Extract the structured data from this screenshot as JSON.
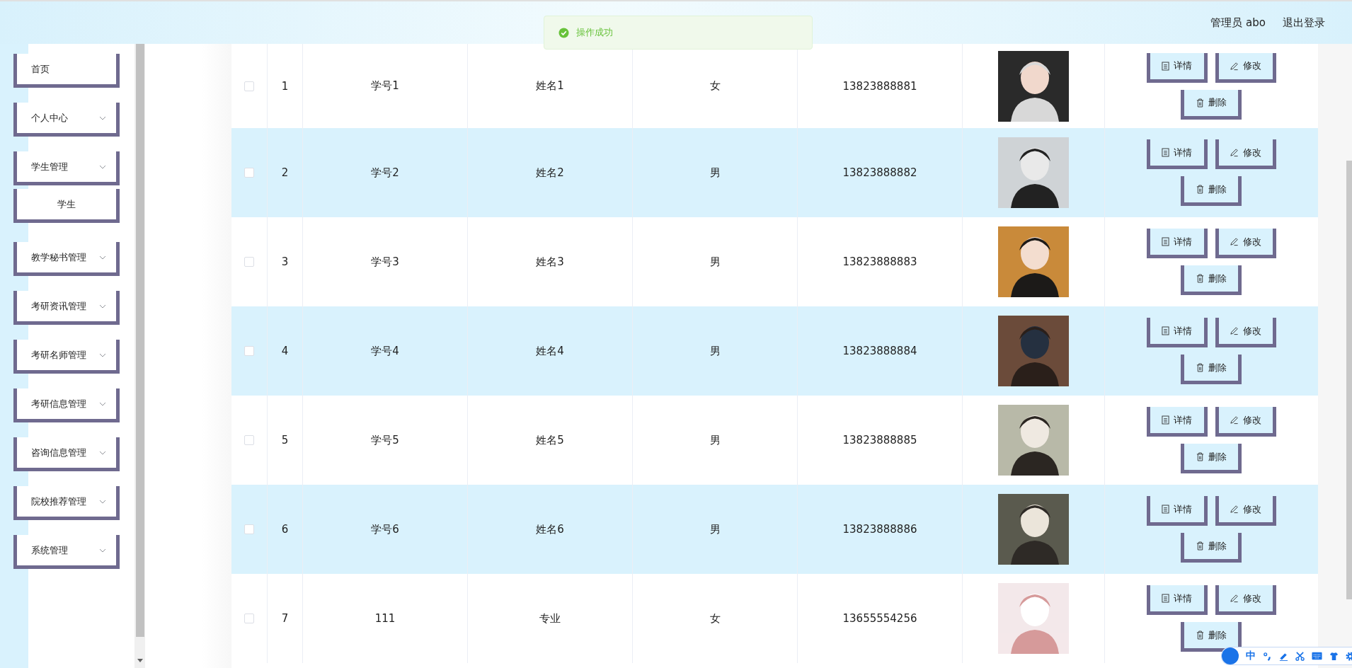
{
  "header": {
    "user": "管理员 abo",
    "logout": "退出登录"
  },
  "toast": {
    "message": "操作成功"
  },
  "sidebar": {
    "items": [
      {
        "label": "首页",
        "kind": "link"
      },
      {
        "label": "个人中心",
        "kind": "submenu"
      },
      {
        "label": "学生管理",
        "kind": "submenu",
        "children": [
          {
            "label": "学生"
          }
        ]
      },
      {
        "label": "教学秘书管理",
        "kind": "submenu"
      },
      {
        "label": "考研资讯管理",
        "kind": "submenu"
      },
      {
        "label": "考研名师管理",
        "kind": "submenu"
      },
      {
        "label": "考研信息管理",
        "kind": "submenu"
      },
      {
        "label": "咨询信息管理",
        "kind": "submenu"
      },
      {
        "label": "院校推荐管理",
        "kind": "submenu"
      },
      {
        "label": "系统管理",
        "kind": "submenu"
      }
    ]
  },
  "table": {
    "rows": [
      {
        "checked": false,
        "index": "1",
        "student_no": "学号1",
        "name": "姓名1",
        "gender": "女",
        "phone": "13823888881",
        "actions": [
          {
            "kind": "detail",
            "label": "详情"
          },
          {
            "kind": "edit",
            "label": "修改"
          },
          {
            "kind": "delete",
            "label": "删除"
          }
        ]
      },
      {
        "checked": false,
        "index": "2",
        "student_no": "学号2",
        "name": "姓名2",
        "gender": "男",
        "phone": "13823888882",
        "actions": [
          {
            "kind": "detail",
            "label": "详情"
          },
          {
            "kind": "edit",
            "label": "修改"
          },
          {
            "kind": "delete",
            "label": "删除"
          }
        ]
      },
      {
        "checked": false,
        "index": "3",
        "student_no": "学号3",
        "name": "姓名3",
        "gender": "男",
        "phone": "13823888883",
        "actions": [
          {
            "kind": "detail",
            "label": "详情"
          },
          {
            "kind": "edit",
            "label": "修改"
          },
          {
            "kind": "delete",
            "label": "删除"
          }
        ]
      },
      {
        "checked": false,
        "index": "4",
        "student_no": "学号4",
        "name": "姓名4",
        "gender": "男",
        "phone": "13823888884",
        "actions": [
          {
            "kind": "detail",
            "label": "详情"
          },
          {
            "kind": "edit",
            "label": "修改"
          },
          {
            "kind": "delete",
            "label": "删除"
          }
        ]
      },
      {
        "checked": false,
        "index": "5",
        "student_no": "学号5",
        "name": "姓名5",
        "gender": "男",
        "phone": "13823888885",
        "actions": [
          {
            "kind": "detail",
            "label": "详情"
          },
          {
            "kind": "edit",
            "label": "修改"
          },
          {
            "kind": "delete",
            "label": "删除"
          }
        ]
      },
      {
        "checked": false,
        "index": "6",
        "student_no": "学号6",
        "name": "姓名6",
        "gender": "男",
        "phone": "13823888886",
        "actions": [
          {
            "kind": "detail",
            "label": "详情"
          },
          {
            "kind": "edit",
            "label": "修改"
          },
          {
            "kind": "delete",
            "label": "删除"
          }
        ]
      },
      {
        "checked": false,
        "index": "7",
        "student_no": "111",
        "name": "专业",
        "gender": "女",
        "phone": "13655554256",
        "actions": [
          {
            "kind": "detail",
            "label": "详情"
          },
          {
            "kind": "edit",
            "label": "修改"
          },
          {
            "kind": "delete",
            "label": "删除"
          }
        ]
      }
    ]
  },
  "ime_toolbar": {
    "mode": "中"
  }
}
